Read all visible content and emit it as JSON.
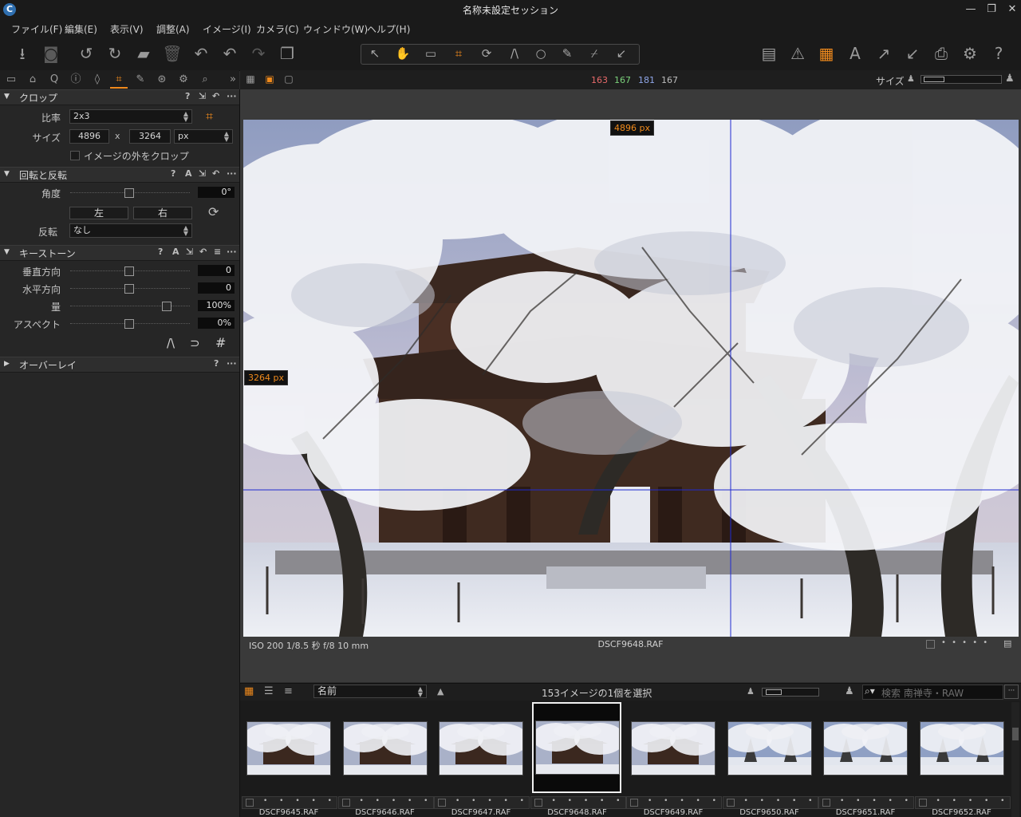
{
  "window": {
    "title": "名称未設定セッション",
    "app_icon_glyph": "C",
    "controls": [
      "—",
      "❐",
      "✕"
    ]
  },
  "menu": [
    "ファイル(F)",
    "編集(E)",
    "表示(V)",
    "調整(A)",
    "イメージ(I)",
    "カメラ(C)",
    "ウィンドウ(W)",
    "ヘルプ(H)"
  ],
  "toolbar": {
    "left_icons": [
      "import-icon",
      "camera-icon",
      "rotate-left-icon",
      "rotate-right-icon",
      "move-to-icon",
      "delete-icon",
      "undo-icon",
      "undo-step-icon",
      "redo-icon",
      "variants-icon"
    ],
    "cursor_tools": [
      "select-tool-icon",
      "hand-tool-icon",
      "loupe-tool-icon",
      "crop-tool-icon",
      "rotate-tool-icon",
      "keystone-tool-icon",
      "spot-tool-icon",
      "brush-tool-icon",
      "picker-tool-icon",
      "mask-tool-icon"
    ],
    "right_icons": [
      "layout-icon",
      "exposure-warning-icon",
      "grid-icon",
      "text-icon",
      "process-icon",
      "import-arrow-icon",
      "print-icon",
      "settings-icon",
      "help-icon"
    ]
  },
  "tool_tabs": [
    "library-tab",
    "capture-tab",
    "lens-tab",
    "exposure-tab",
    "color-tab",
    "crop-tab",
    "adjust-tab",
    "details-tab",
    "settings-tab",
    "search-tab"
  ],
  "viewer_header": {
    "rgb": {
      "r": "163",
      "g": "167",
      "b": "181",
      "l": "167"
    },
    "size_label": "サイズ",
    "colors": {
      "r": "#e86a6a",
      "g": "#7ad07a",
      "b": "#8fa6e8",
      "l": "#bdbdbd",
      "accent": "#f08a1c"
    }
  },
  "crop": {
    "title": "クロップ",
    "ratio_label": "比率",
    "ratio_value": "2x3",
    "size_label": "サイズ",
    "width": "4896",
    "x_label": "x",
    "height": "3264",
    "unit": "px",
    "outside_label": "イメージの外をクロップ"
  },
  "rotate": {
    "title": "回転と反転",
    "angle_label": "角度",
    "angle_value": "0°",
    "left_label": "左",
    "right_label": "右",
    "flip_label": "反転",
    "flip_value": "なし"
  },
  "keystone": {
    "title": "キーストーン",
    "rows": [
      {
        "label": "垂直方向",
        "value": "0"
      },
      {
        "label": "水平方向",
        "value": "0"
      },
      {
        "label": "量",
        "value": "100%"
      },
      {
        "label": "アスペクト",
        "value": "0%"
      }
    ]
  },
  "overlay": {
    "title": "オーバーレイ"
  },
  "section_controls": {
    "help": "?",
    "auto": "A",
    "copy": "⇲",
    "reset": "↶",
    "menu": "···"
  },
  "viewer": {
    "width_badge": "4896 px",
    "height_badge": "3264 px",
    "exif": "ISO 200  1/8.5 秒  f/8  10 mm",
    "filename": "DSCF9648.RAF",
    "rating": "• • • • •"
  },
  "browser": {
    "sort_value": "名前",
    "status": "153イメージの1個を選択",
    "search_placeholder": "検索 南禅寺・RAW",
    "thumbnails": [
      {
        "name": "DSCF9645.RAF",
        "selected": false,
        "variant": "gate"
      },
      {
        "name": "DSCF9646.RAF",
        "selected": false,
        "variant": "gate"
      },
      {
        "name": "DSCF9647.RAF",
        "selected": false,
        "variant": "gate"
      },
      {
        "name": "DSCF9648.RAF",
        "selected": true,
        "variant": "gate"
      },
      {
        "name": "DSCF9649.RAF",
        "selected": false,
        "variant": "gate"
      },
      {
        "name": "DSCF9650.RAF",
        "selected": false,
        "variant": "trees"
      },
      {
        "name": "DSCF9651.RAF",
        "selected": false,
        "variant": "trees"
      },
      {
        "name": "DSCF9652.RAF",
        "selected": false,
        "variant": "trees"
      }
    ],
    "rating_dots": "• • • • •"
  }
}
